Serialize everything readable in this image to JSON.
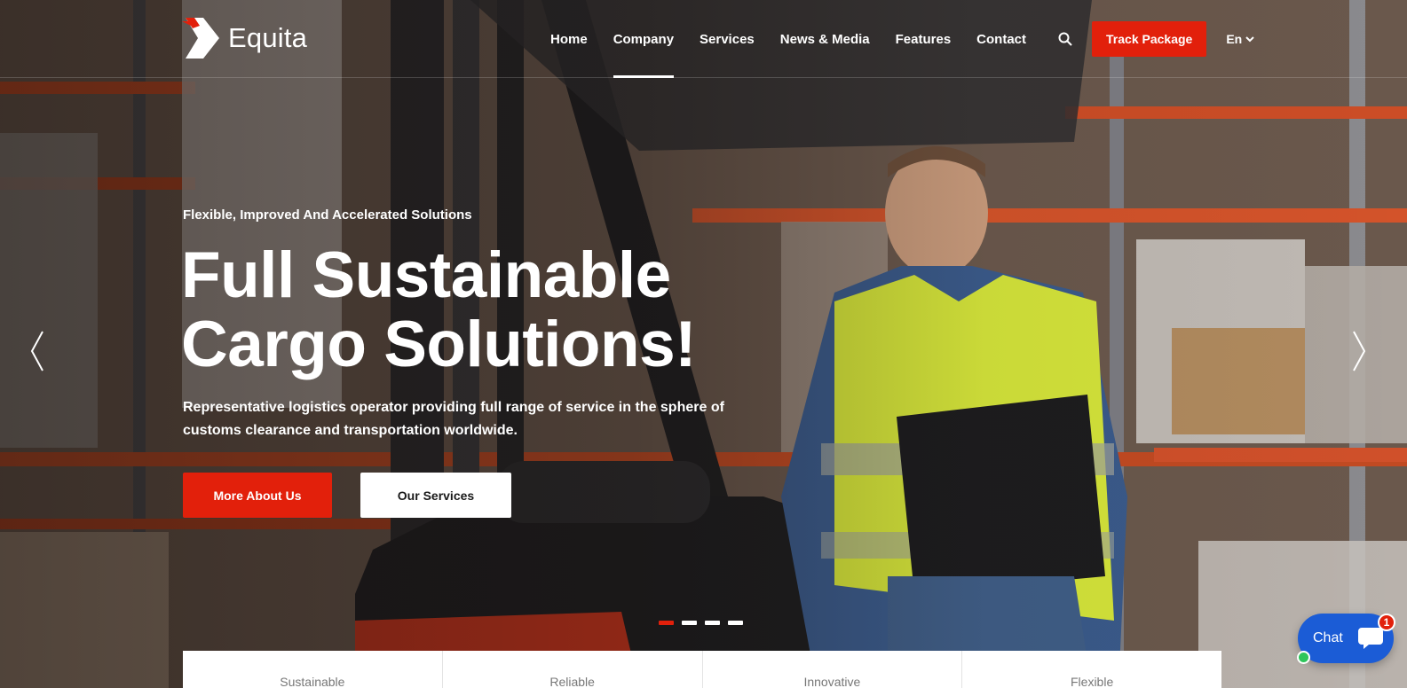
{
  "brand": {
    "name": "Equita",
    "accent": "#e2200b"
  },
  "nav": {
    "items": [
      {
        "label": "Home"
      },
      {
        "label": "Company",
        "active": true
      },
      {
        "label": "Services"
      },
      {
        "label": "News & Media"
      },
      {
        "label": "Features"
      },
      {
        "label": "Contact"
      }
    ],
    "search_icon": "search-icon",
    "track_label": "Track Package",
    "lang": "En"
  },
  "hero": {
    "subtitle": "Flexible, Improved And Accelerated Solutions",
    "headline_line1": "Full Sustainable",
    "headline_line2": "Cargo Solutions!",
    "description": "Representative logistics operator providing full range of service in the sphere of customs clearance and transportation worldwide.",
    "primary_button": "More About Us",
    "secondary_button": "Our Services",
    "slides_count": 4,
    "active_slide": 1
  },
  "features": [
    "Sustainable",
    "Reliable",
    "Innovative",
    "Flexible"
  ],
  "chat": {
    "label": "Chat",
    "unread": "1",
    "status_color": "#2ec65b",
    "button_color": "#1b5cd6"
  }
}
